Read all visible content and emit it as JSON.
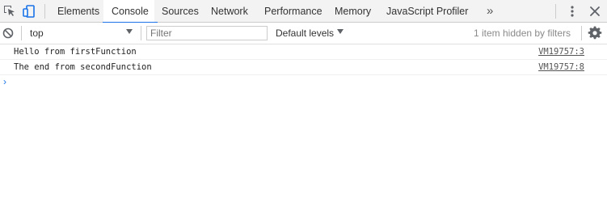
{
  "tabbar": {
    "tabs": [
      {
        "label": "Elements"
      },
      {
        "label": "Console",
        "active": true
      },
      {
        "label": "Sources"
      },
      {
        "label": "Network"
      },
      {
        "label": "Performance"
      },
      {
        "label": "Memory"
      },
      {
        "label": "JavaScript Profiler"
      }
    ],
    "overflow_label": "»",
    "accent_color": "#1a73e8"
  },
  "toolbar": {
    "context": "top",
    "filter_placeholder": "Filter",
    "levels_label": "Default levels",
    "hidden_count": "1 item hidden by filters"
  },
  "console": {
    "messages": [
      {
        "text": "Hello from firstFunction",
        "source": "VM19757:3"
      },
      {
        "text": "The end from secondFunction",
        "source": "VM19757:8"
      }
    ],
    "prompt_symbol": "›"
  }
}
